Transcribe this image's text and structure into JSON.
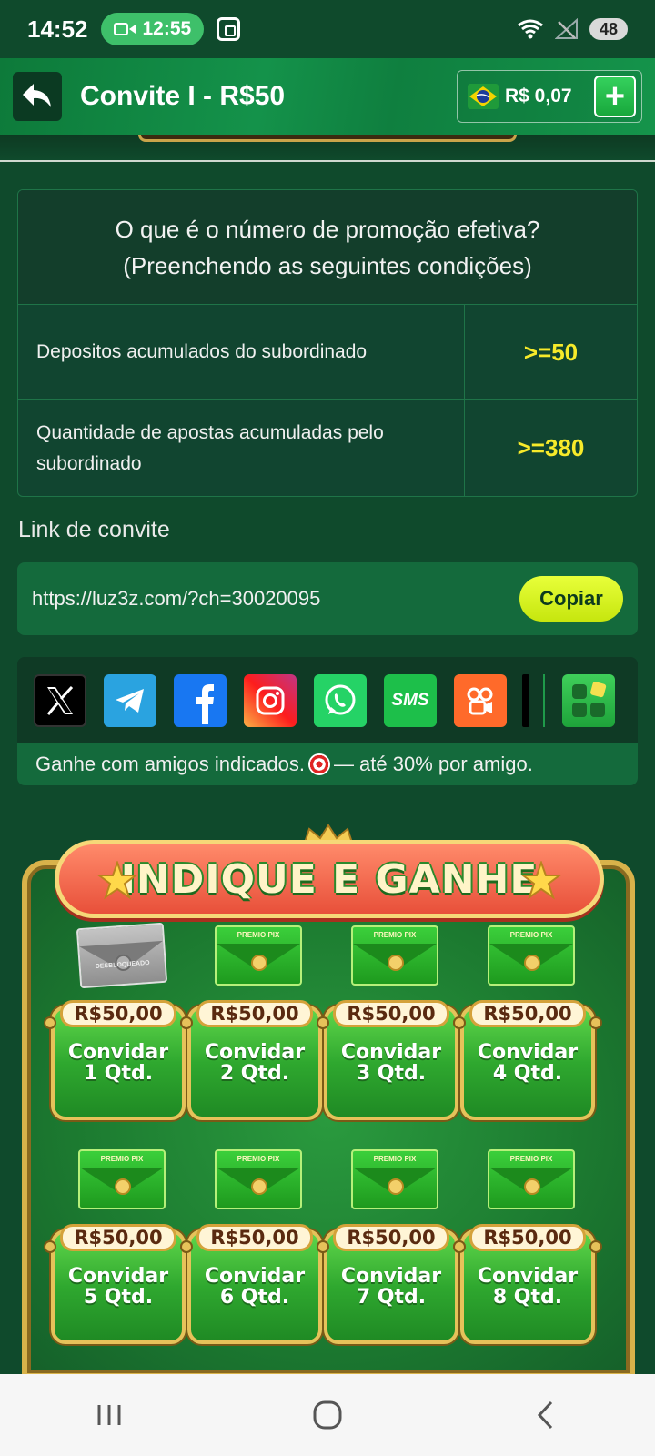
{
  "status_bar": {
    "time": "14:52",
    "recording_time": "12:55",
    "battery": "48"
  },
  "header": {
    "title": "Convite I - R$50",
    "balance": "R$ 0,07",
    "add_label": "+"
  },
  "rules": {
    "question_line1": "O que é o número de promoção efetiva?",
    "question_line2": "(Preenchendo as seguintes condições)",
    "rows": [
      {
        "label": "Depositos acumulados do subordinado",
        "value": ">=50"
      },
      {
        "label": "Quantidade de apostas acumuladas pelo subordinado",
        "value": ">=380"
      }
    ]
  },
  "invite": {
    "section_label": "Link de convite",
    "link": "https://luz3z.com/?ch=30020095",
    "copy_label": "Copiar"
  },
  "share": {
    "icons": [
      "x-icon",
      "telegram-icon",
      "facebook-icon",
      "instagram-icon",
      "whatsapp-icon",
      "sms-icon",
      "kwai-icon",
      "tiktok-icon",
      "apps-icon"
    ],
    "sms_label": "SMS",
    "caption_before": "Ganhe com amigos indicados.",
    "caption_after": "— até 30% por amigo."
  },
  "promo": {
    "title": "INDIQUE E GANHE",
    "envelope_label": "PREMIO PIX",
    "locked_label": "DESBLOQUEADO",
    "tiles": [
      {
        "price": "R$50,00",
        "action": "Convidar",
        "qty": "1 Qtd.",
        "locked": true
      },
      {
        "price": "R$50,00",
        "action": "Convidar",
        "qty": "2 Qtd.",
        "locked": false
      },
      {
        "price": "R$50,00",
        "action": "Convidar",
        "qty": "3 Qtd.",
        "locked": false
      },
      {
        "price": "R$50,00",
        "action": "Convidar",
        "qty": "4 Qtd.",
        "locked": false
      },
      {
        "price": "R$50,00",
        "action": "Convidar",
        "qty": "5 Qtd.",
        "locked": false
      },
      {
        "price": "R$50,00",
        "action": "Convidar",
        "qty": "6 Qtd.",
        "locked": false
      },
      {
        "price": "R$50,00",
        "action": "Convidar",
        "qty": "7 Qtd.",
        "locked": false
      },
      {
        "price": "R$50,00",
        "action": "Convidar",
        "qty": "8 Qtd.",
        "locked": false
      }
    ]
  },
  "colors": {
    "background": "#0f4a2c",
    "accent_yellow": "#f7ea2a",
    "copy_button": "#d4f21e",
    "header_green": "#14924a"
  }
}
